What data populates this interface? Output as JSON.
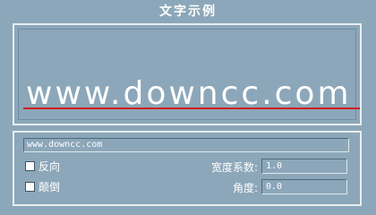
{
  "window": {
    "title": "文字示例"
  },
  "preview": {
    "text": "www.downcc.com"
  },
  "controls": {
    "text_input_value": "www.downcc.com",
    "reverse_label": "反向",
    "invert_label": "颠倒",
    "width_factor_label": "宽度系数:",
    "width_factor_value": "1.0",
    "angle_label": "角度:",
    "angle_value": "0.0"
  },
  "colors": {
    "background": "#8ca7b9",
    "preview_text": "#ffffff",
    "baseline": "#d21e1e"
  }
}
